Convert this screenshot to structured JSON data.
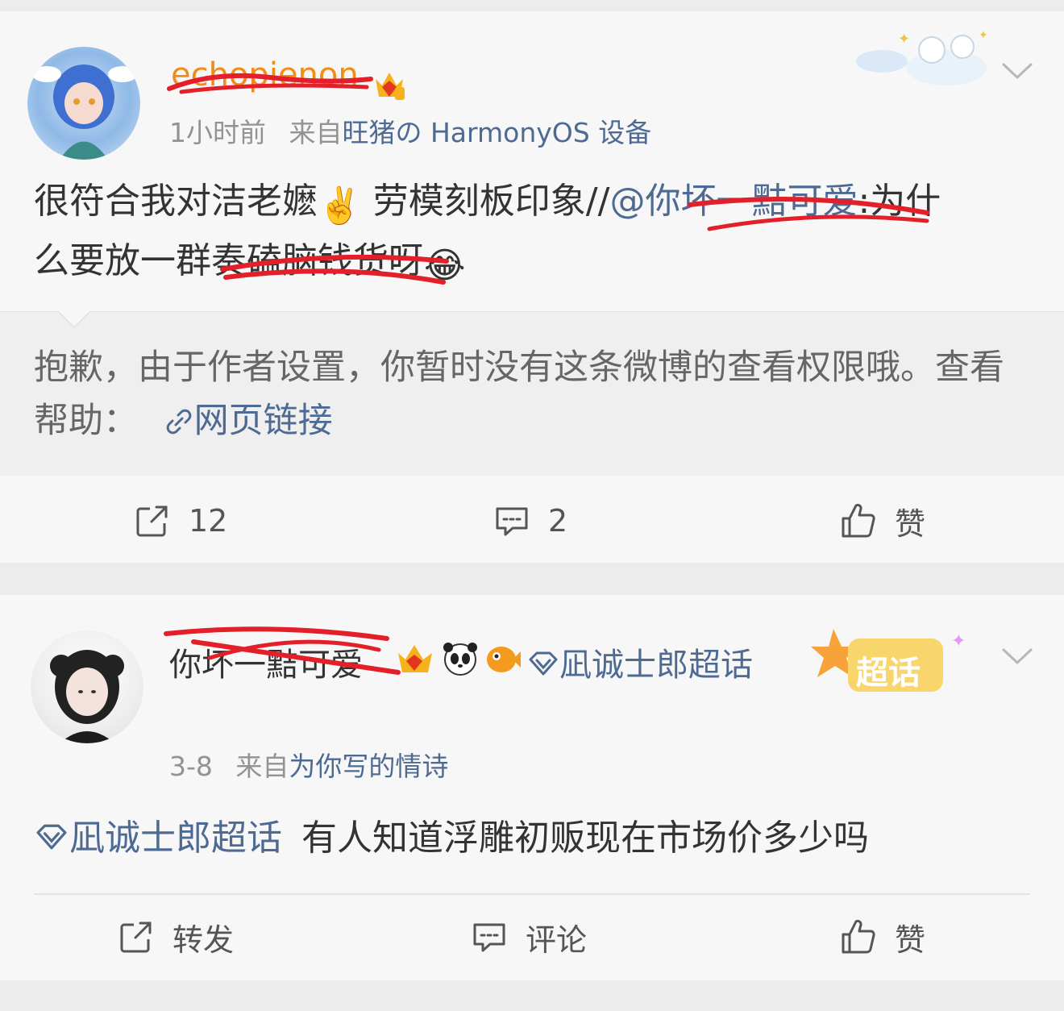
{
  "post1": {
    "username": "echopienon",
    "time": "1小时前",
    "source_prefix": "来自",
    "source": "旺猪の HarmonyOS 设备",
    "text_a": "很符合我对洁老嬷",
    "emoji_a": "✌️",
    "text_b": "劳模刻板印象//",
    "mention": "@你坏一黠可爱",
    "text_c": ":为什",
    "text_d": "么要放一群",
    "text_e": "奏磕脑钱货",
    "text_f": "呀",
    "emoji_b": "😂",
    "repost_notice": "抱歉，由于作者设置，你暂时没有这条微博的查看权限哦。查看帮助：",
    "repost_link": "网页链接",
    "actions": {
      "repost_count": "12",
      "comment_count": "2",
      "like_label": "赞"
    }
  },
  "post2": {
    "username": "你坏一黠可爱",
    "topic_badge": "凪诚士郎超话",
    "supertopic_sticker": "超话",
    "time": "3-8",
    "source_prefix": "来自",
    "source": "为你写的情诗",
    "topic": "凪诚士郎超话",
    "text": "有人知道浮雕初贩现在市场价多少吗",
    "actions": {
      "repost_label": "转发",
      "comment_label": "评论",
      "like_label": "赞"
    }
  },
  "colors": {
    "link": "#4e6a93",
    "vip_orange": "#f28c17",
    "redaction": "#e3202a"
  }
}
